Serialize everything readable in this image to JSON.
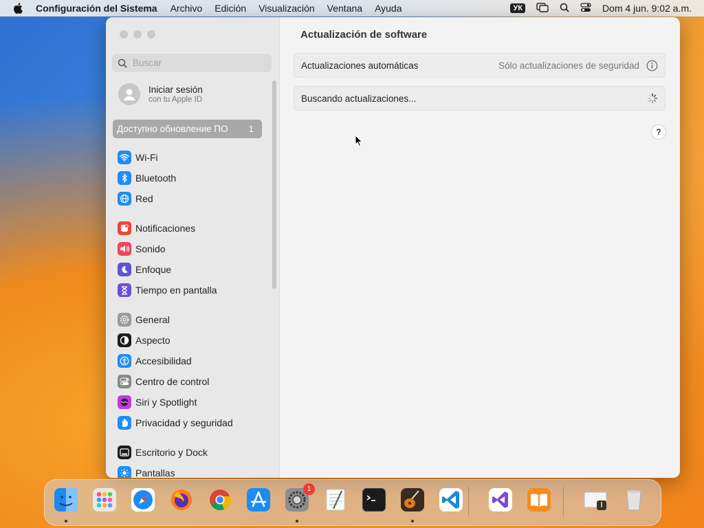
{
  "menubar": {
    "app_name": "Configuración del Sistema",
    "menus": [
      "Archivo",
      "Edición",
      "Visualización",
      "Ventana",
      "Ayuda"
    ],
    "input_source": "УК",
    "datetime": "Dom 4 jun.  9:02 a.m."
  },
  "sidebar": {
    "search_placeholder": "Buscar",
    "account": {
      "title": "Iniciar sesión",
      "subtitle": "con tu Apple ID"
    },
    "update_notice": {
      "label": "Доступно обновление ПО",
      "count": "1"
    },
    "items": [
      {
        "label": "Wi-Fi",
        "icon": "wifi-icon",
        "color": "#1f8df5"
      },
      {
        "label": "Bluetooth",
        "icon": "bluetooth-icon",
        "color": "#1f8df5"
      },
      {
        "label": "Red",
        "icon": "globe-icon",
        "color": "#1f8df5"
      },
      {
        "label": "Notificaciones",
        "icon": "bell-icon",
        "color": "#f0453a"
      },
      {
        "label": "Sonido",
        "icon": "speaker-icon",
        "color": "#f0455c"
      },
      {
        "label": "Enfoque",
        "icon": "moon-icon",
        "color": "#5e55d6"
      },
      {
        "label": "Tiempo en pantalla",
        "icon": "hourglass-icon",
        "color": "#6b4fd6"
      },
      {
        "label": "General",
        "icon": "gear-icon",
        "color": "#9a9a9a"
      },
      {
        "label": "Aspecto",
        "icon": "appearance-icon",
        "color": "#1b1b1b"
      },
      {
        "label": "Accesibilidad",
        "icon": "accessibility-icon",
        "color": "#1f8df5"
      },
      {
        "label": "Centro de control",
        "icon": "control-center-icon",
        "color": "#8a8a8a"
      },
      {
        "label": "Siri y Spotlight",
        "icon": "siri-icon",
        "color": "#c23ed8"
      },
      {
        "label": "Privacidad y seguridad",
        "icon": "hand-icon",
        "color": "#1f8df5"
      },
      {
        "label": "Escritorio y Dock",
        "icon": "desktop-icon",
        "color": "#1b1b1b"
      },
      {
        "label": "Pantallas",
        "icon": "sun-icon",
        "color": "#1f8df5"
      }
    ]
  },
  "content": {
    "title": "Actualización de software",
    "auto_updates": {
      "label": "Actualizaciones automáticas",
      "value": "Sólo actualizaciones de seguridad"
    },
    "status": "Buscando actualizaciones...",
    "help": "?"
  },
  "dock": {
    "apps": [
      {
        "name": "finder-icon",
        "color": "#1e88f0"
      },
      {
        "name": "launchpad-icon",
        "color": "#e5e5e5"
      },
      {
        "name": "safari-icon",
        "color": "#1c8cf2"
      },
      {
        "name": "firefox-icon",
        "color": "#5b2fa8"
      },
      {
        "name": "chrome-icon",
        "color": "#ffffff"
      },
      {
        "name": "app-store-icon",
        "color": "#1c8cf2"
      },
      {
        "name": "system-settings-icon",
        "color": "#8d8d8d"
      },
      {
        "name": "textedit-icon",
        "color": "#f4f4f4"
      },
      {
        "name": "terminal-icon",
        "color": "#1b1b1b"
      },
      {
        "name": "garageband-icon",
        "color": "#3a2a20"
      },
      {
        "name": "vscode-icon",
        "color": "#ffffff"
      },
      {
        "name": "visual-studio-icon",
        "color": "#ffffff"
      },
      {
        "name": "books-icon",
        "color": "#f48c1b"
      },
      {
        "name": "downloads-stack-icon",
        "color": "#eeeeee"
      },
      {
        "name": "trash-icon",
        "color": "#d8d8d8"
      }
    ],
    "settings_badge": "1"
  }
}
